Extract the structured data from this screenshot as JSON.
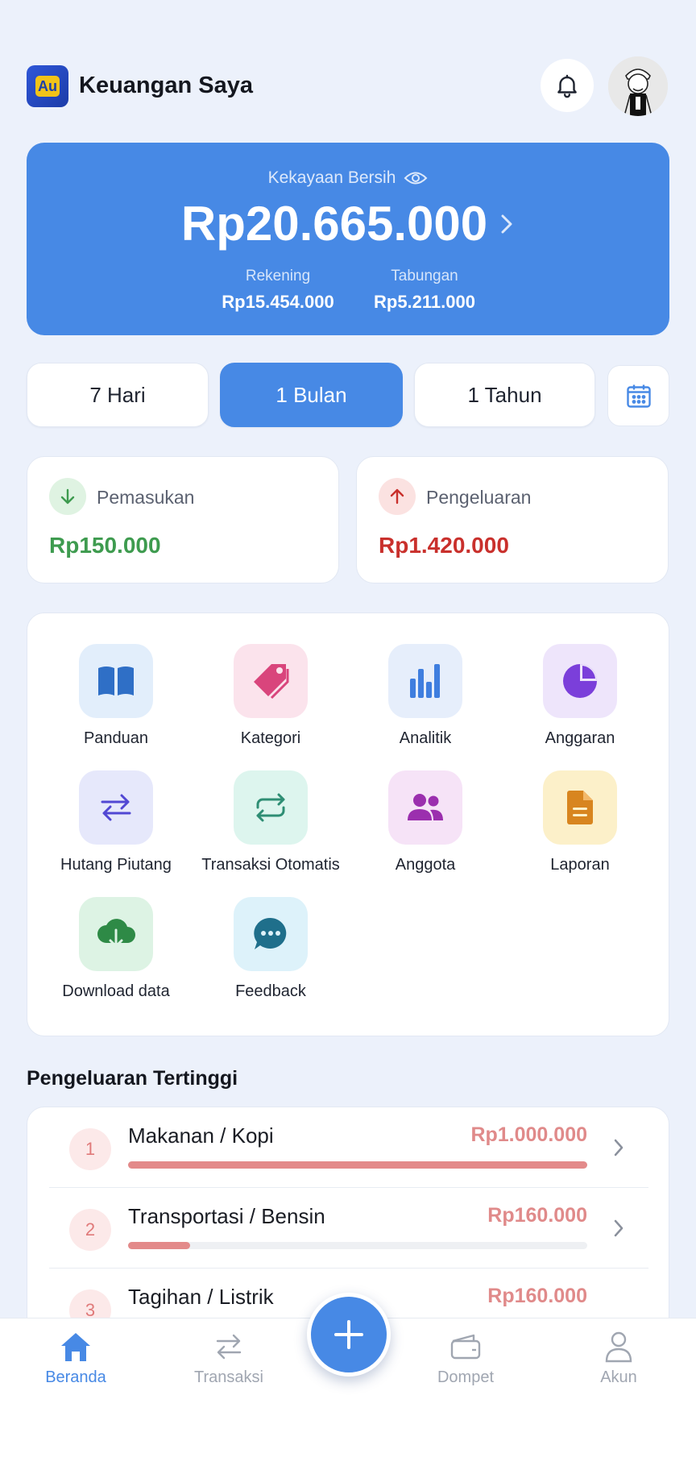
{
  "header": {
    "logo_text": "Au",
    "title": "Keuangan Saya"
  },
  "net_worth": {
    "label": "Kekayaan Bersih",
    "amount": "Rp20.665.000",
    "accounts_label": "Rekening",
    "accounts_value": "Rp15.454.000",
    "savings_label": "Tabungan",
    "savings_value": "Rp5.211.000"
  },
  "periods": [
    {
      "label": "7 Hari",
      "active": false
    },
    {
      "label": "1 Bulan",
      "active": true
    },
    {
      "label": "1 Tahun",
      "active": false
    }
  ],
  "income": {
    "label": "Pemasukan",
    "value": "Rp150.000",
    "color": "#3E9B4F"
  },
  "expense": {
    "label": "Pengeluaran",
    "value": "Rp1.420.000",
    "color": "#C9302C"
  },
  "menu": [
    {
      "label": "Panduan",
      "icon": "book-icon"
    },
    {
      "label": "Kategori",
      "icon": "tag-icon"
    },
    {
      "label": "Analitik",
      "icon": "bar-chart-icon"
    },
    {
      "label": "Anggaran",
      "icon": "pie-chart-icon"
    },
    {
      "label": "Hutang Piutang",
      "icon": "swap-arrows-icon"
    },
    {
      "label": "Transaksi Otomatis",
      "icon": "repeat-icon"
    },
    {
      "label": "Anggota",
      "icon": "users-icon"
    },
    {
      "label": "Laporan",
      "icon": "document-icon"
    },
    {
      "label": "Download data",
      "icon": "cloud-download-icon"
    },
    {
      "label": "Feedback",
      "icon": "chat-bubble-icon"
    }
  ],
  "top_expenses": {
    "title": "Pengeluaran Tertinggi",
    "items": [
      {
        "rank": "1",
        "name": "Makanan / Kopi",
        "amount": "Rp1.000.000",
        "fraction": 1.0
      },
      {
        "rank": "2",
        "name": "Transportasi / Bensin",
        "amount": "Rp160.000",
        "fraction": 0.135
      },
      {
        "rank": "3",
        "name": "Tagihan / Listrik",
        "amount": "Rp160.000",
        "fraction": 0.135
      }
    ]
  },
  "nav": {
    "home": "Beranda",
    "transactions": "Transaksi",
    "wallet": "Dompet",
    "account": "Akun"
  },
  "colors": {
    "accent": "#4789E5",
    "background": "#ECF1FB"
  }
}
